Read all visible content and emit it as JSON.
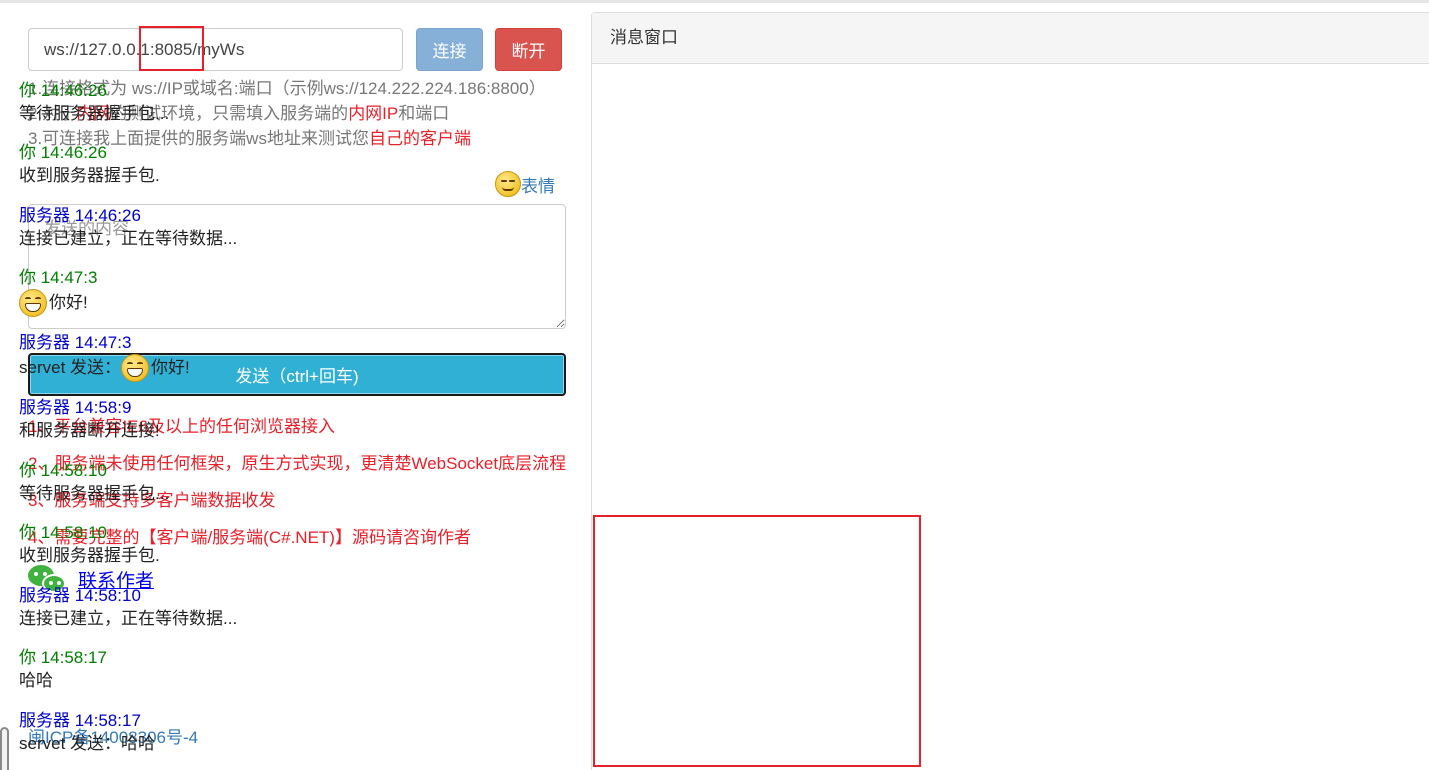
{
  "connection": {
    "url_value": "ws://127.0.0.1:8085/myWs",
    "connect_label": "连接",
    "disconnect_label": "断开"
  },
  "tips": [
    {
      "plain": "1.连接格式为 ws://IP或域名:端口（示例ws://124.222.224.186:8800）"
    },
    {
      "a": "2.对于",
      "r1": "内网",
      "b": "的测试环境，只需填入服务端的",
      "r2": "内网IP",
      "c": "和端口"
    },
    {
      "a": "3.可连接我上面提供的服务端ws地址来测试您",
      "r1": "自己的客户端"
    }
  ],
  "emoji_label": "表情",
  "composer": {
    "placeholder": "发送的内容",
    "send_label": "发送（ctrl+回车)"
  },
  "features": [
    "1、平台兼容IE6及以上的任何浏览器接入",
    "2、服务端未使用任何框架，原生方式实现，更清楚WebSocket底层流程",
    "3、服务端支持多客户端数据收发",
    "4、需要完整的【客户端/服务端(C#.NET)】源码请咨询作者"
  ],
  "contact_label": "联系作者",
  "icp_label": "闽ICP备14008306号-4",
  "panel": {
    "title": "消息窗口",
    "messages": [
      {
        "sender": "你 14:46:26",
        "role": "you",
        "text": "等待服务器握手包..."
      },
      {
        "sender": "你 14:46:26",
        "role": "you",
        "text": "收到服务器握手包."
      },
      {
        "sender": "服务器 14:46:26",
        "role": "server",
        "text": "连接已建立，正在等待数据..."
      },
      {
        "sender": "你 14:47:3",
        "role": "you",
        "text": "你好!",
        "emoji": "grin-icon"
      },
      {
        "sender": "服务器 14:47:3",
        "role": "server",
        "prefix": "servet 发送：",
        "text": "你好!",
        "emoji": "grin-icon"
      },
      {
        "sender": "服务器 14:58:9",
        "role": "server",
        "text": "和服务器断开连接!"
      },
      {
        "sender": "你 14:58:10",
        "role": "you",
        "text": "等待服务器握手包..."
      },
      {
        "sender": "你 14:58:10",
        "role": "you",
        "text": "收到服务器握手包."
      },
      {
        "sender": "服务器 14:58:10",
        "role": "server",
        "text": "连接已建立，正在等待数据..."
      },
      {
        "sender": "你 14:58:17",
        "role": "you",
        "text": "哈哈"
      },
      {
        "sender": "服务器 14:58:17",
        "role": "server",
        "text": "servet 发送：哈哈"
      }
    ]
  },
  "colors": {
    "accent_red": "#e8202a",
    "you_green": "#008000",
    "server_blue": "#0000cc",
    "send_button": "#31b0d5",
    "connect_button": "#86b0d8",
    "disconnect_button": "#d9534f"
  }
}
